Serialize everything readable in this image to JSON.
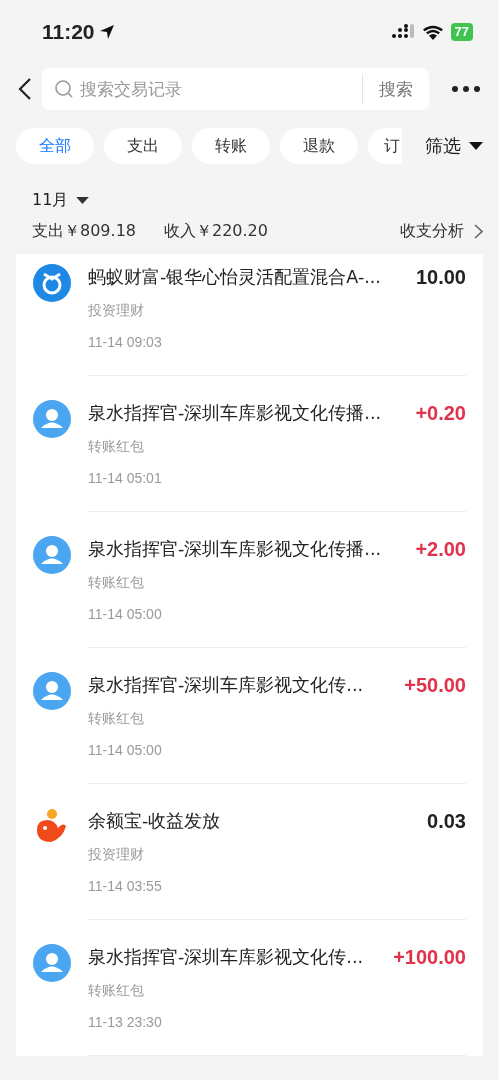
{
  "status_bar": {
    "time": "11:20",
    "battery": "77"
  },
  "search": {
    "placeholder": "搜索交易记录",
    "button": "搜索"
  },
  "tabs": [
    {
      "label": "全部",
      "selected": true
    },
    {
      "label": "支出",
      "selected": false
    },
    {
      "label": "转账",
      "selected": false
    },
    {
      "label": "退款",
      "selected": false
    },
    {
      "label": "订",
      "selected": false
    }
  ],
  "filter": "筛选",
  "month": "11月",
  "summary": {
    "expense": "支出￥809.18",
    "income": "收入￥220.20",
    "analysis": "收支分析"
  },
  "transactions": [
    {
      "kind": "fund",
      "title": "蚂蚁财富-银华心怡灵活配置混合A-...",
      "category": "投资理财",
      "time": "11-14 09:03",
      "amount": "10.00",
      "income": false
    },
    {
      "kind": "person",
      "title": "泉水指挥官-深圳车库影视文化传播...",
      "category": "转账红包",
      "time": "11-14 05:01",
      "amount": "+0.20",
      "income": true
    },
    {
      "kind": "person",
      "title": "泉水指挥官-深圳车库影视文化传播...",
      "category": "转账红包",
      "time": "11-14 05:00",
      "amount": "+2.00",
      "income": true
    },
    {
      "kind": "person",
      "title": "泉水指挥官-深圳车库影视文化传...",
      "category": "转账红包",
      "time": "11-14 05:00",
      "amount": "+50.00",
      "income": true
    },
    {
      "kind": "yuebao",
      "title": "余额宝-收益发放",
      "category": "投资理财",
      "time": "11-14 03:55",
      "amount": "0.03",
      "income": false
    },
    {
      "kind": "person",
      "title": "泉水指挥官-深圳车库影视文化传...",
      "category": "转账红包",
      "time": "11-13 23:30",
      "amount": "+100.00",
      "income": true
    }
  ]
}
